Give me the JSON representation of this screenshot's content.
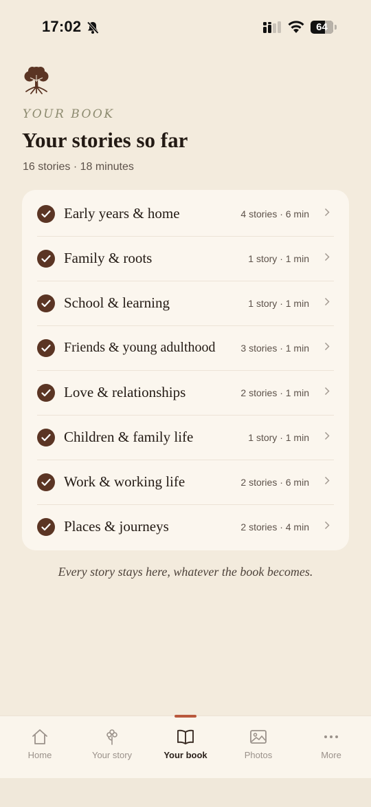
{
  "status": {
    "time": "17:02",
    "battery": "64",
    "battery_level": 0.64
  },
  "header": {
    "eyebrow": "YOUR BOOK",
    "title": "Your stories so far",
    "summary": "16 stories · 18 minutes"
  },
  "chapters": [
    {
      "label": "Early years & home",
      "meta": "4 stories · 6 min"
    },
    {
      "label": "Family & roots",
      "meta": "1 story · 1 min"
    },
    {
      "label": "School & learning",
      "meta": "1 story · 1 min"
    },
    {
      "label": "Friends & young adulthood",
      "meta": "3 stories · 1 min"
    },
    {
      "label": "Love & relationships",
      "meta": "2 stories · 1 min"
    },
    {
      "label": "Children & family life",
      "meta": "1 story · 1 min"
    },
    {
      "label": "Work & working life",
      "meta": "2 stories · 6 min"
    },
    {
      "label": "Places & journeys",
      "meta": "2 stories · 4 min"
    }
  ],
  "footnote": "Every story stays here, whatever the book becomes.",
  "tabs": [
    {
      "label": "Home",
      "icon": "house-icon"
    },
    {
      "label": "Your story",
      "icon": "flower-icon"
    },
    {
      "label": "Your book",
      "icon": "book-icon",
      "active": true
    },
    {
      "label": "Photos",
      "icon": "image-icon"
    },
    {
      "label": "More",
      "icon": "ellipsis-icon"
    }
  ],
  "colors": {
    "background": "#f3ebdd",
    "card": "#fbf6ee",
    "accent": "#5b3524",
    "tab_indicator": "#b9583c"
  }
}
